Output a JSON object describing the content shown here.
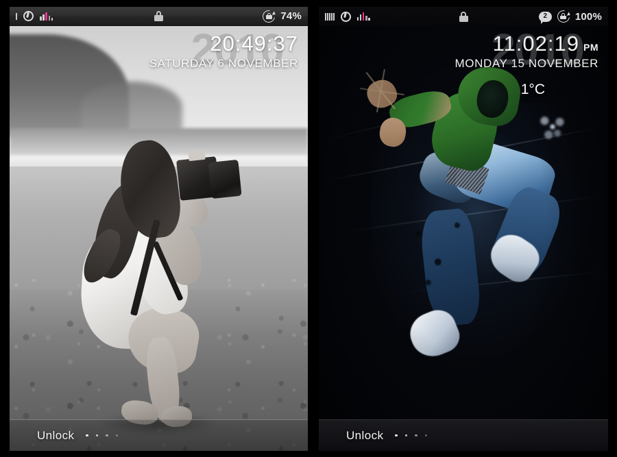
{
  "screens": [
    {
      "id": "left",
      "theme": "light",
      "statusbar": {
        "carrier_icon": "signal-bars-icon",
        "operator_icon": "vodafone-logo-icon",
        "equalizer_icon": "audio-level-icon",
        "lock_icon": "padlock-icon",
        "rotation_lock_icon": "rotation-lock-icon",
        "battery": "74%"
      },
      "clock": {
        "year_watermark": "2010",
        "time": "20:49:37",
        "ampm": "",
        "date": "SATURDAY 6 NOVEMBER",
        "temperature": ""
      },
      "unlock": {
        "label": "Unlock",
        "dot_count": 4
      }
    },
    {
      "id": "right",
      "theme": "dark",
      "statusbar": {
        "carrier_icon": "signal-bars-icon",
        "operator_icon": "vodafone-logo-icon",
        "equalizer_icon": "audio-level-icon",
        "lock_icon": "padlock-icon",
        "message_badge": "2",
        "message_icon": "message-bubble-icon",
        "rotation_lock_icon": "rotation-lock-icon",
        "battery": "100%"
      },
      "clock": {
        "year_watermark": "2010",
        "time": "11:02:19",
        "ampm": "PM",
        "date": "MONDAY 15 NOVEMBER",
        "temperature": "1°C",
        "weather_icon": "snowflake-icon"
      },
      "unlock": {
        "label": "Unlock",
        "dot_count": 4
      }
    }
  ],
  "colors": {
    "accent_pink": "#e8368f",
    "icon_grey": "#d8d8d8",
    "text_white": "#f4f4f4",
    "frame_black": "#000000",
    "dark_wall": "#05070c"
  },
  "equalizer_bars": [
    {
      "height": 6,
      "color": "#cfcfcf"
    },
    {
      "height": 9,
      "color": "#cfcfcf"
    },
    {
      "height": 12,
      "color": "#e8368f"
    },
    {
      "height": 7,
      "color": "#b89aa8"
    },
    {
      "height": 4,
      "color": "#cfcfcf"
    }
  ]
}
